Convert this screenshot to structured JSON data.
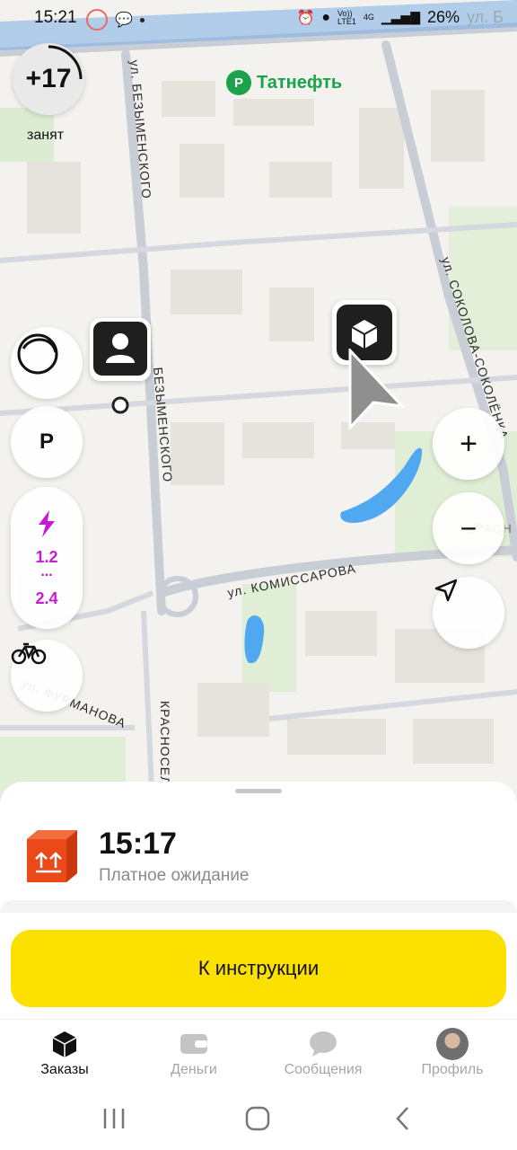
{
  "status": {
    "time": "15:21",
    "volte": "Vo))",
    "lte": "LTE1",
    "net": "4G",
    "battery": "26%",
    "clipped_label": "ул. Безымы"
  },
  "map": {
    "poi_tatneft": "Татнефть",
    "streets": {
      "bezymenskogo_top": "ул. БЕЗЫМЕНСКОГО",
      "bezymenskogo_mid": "БЕЗЫМЕНСКОГО",
      "sokolova": "ул. СОКОЛОВА-СОКОЛЁНКА",
      "komissarova": "ул. КОМИССАРОВА",
      "furmanova": "ул. ФУРМАНОВА",
      "krasnosel": "КРАСНОСЕЛ",
      "krasn_right": "КРАСН"
    }
  },
  "controls": {
    "queue_count": "+17",
    "queue_status": "занят",
    "parking_label": "P",
    "surge_top": "1.2",
    "surge_dots": "...",
    "surge_bottom": "2.4",
    "zoom_in": "+",
    "zoom_out": "−"
  },
  "order": {
    "time": "15:17",
    "subtitle": "Платное ожидание",
    "action_button": "К инструкции"
  },
  "tabs": [
    {
      "label": "Заказы",
      "active": true
    },
    {
      "label": "Деньги",
      "active": false
    },
    {
      "label": "Сообщения",
      "active": false
    },
    {
      "label": "Профиль",
      "active": false
    }
  ],
  "colors": {
    "accent_yellow": "#fce000",
    "surge_purple": "#c71ad6",
    "tatneft_green": "#1aa34a",
    "box_orange": "#ea4a1a"
  }
}
